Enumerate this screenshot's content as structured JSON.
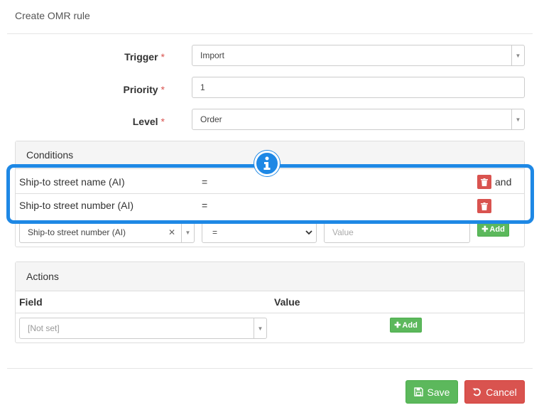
{
  "dialog": {
    "title": "Create OMR rule"
  },
  "form": {
    "trigger": {
      "label": "Trigger",
      "required": "*",
      "value": "Import"
    },
    "priority": {
      "label": "Priority",
      "required": "*",
      "value": "1"
    },
    "level": {
      "label": "Level",
      "required": "*",
      "value": "Order"
    }
  },
  "conditions": {
    "title": "Conditions",
    "rows": [
      {
        "field": "Ship-to street name (AI)",
        "operator": "=",
        "connector": "and"
      },
      {
        "field": "Ship-to street number (AI)",
        "operator": "=",
        "connector": ""
      }
    ],
    "new_row": {
      "field": "Ship-to street number (AI)",
      "operator": "=",
      "value_placeholder": "Value",
      "add_label": "Add"
    }
  },
  "actions": {
    "title": "Actions",
    "columns": [
      "Field",
      "Value"
    ],
    "field_value": "[Not set]",
    "add_label": "Add"
  },
  "footer": {
    "save_label": "Save",
    "cancel_label": "Cancel"
  },
  "colors": {
    "primary_success": "#5cb85c",
    "danger": "#d9534f",
    "highlight": "#1e88e5"
  },
  "icons": [
    "info-icon",
    "trash-icon",
    "plus-icon",
    "save-icon",
    "undo-icon",
    "chevron-down-icon",
    "clear-icon"
  ]
}
